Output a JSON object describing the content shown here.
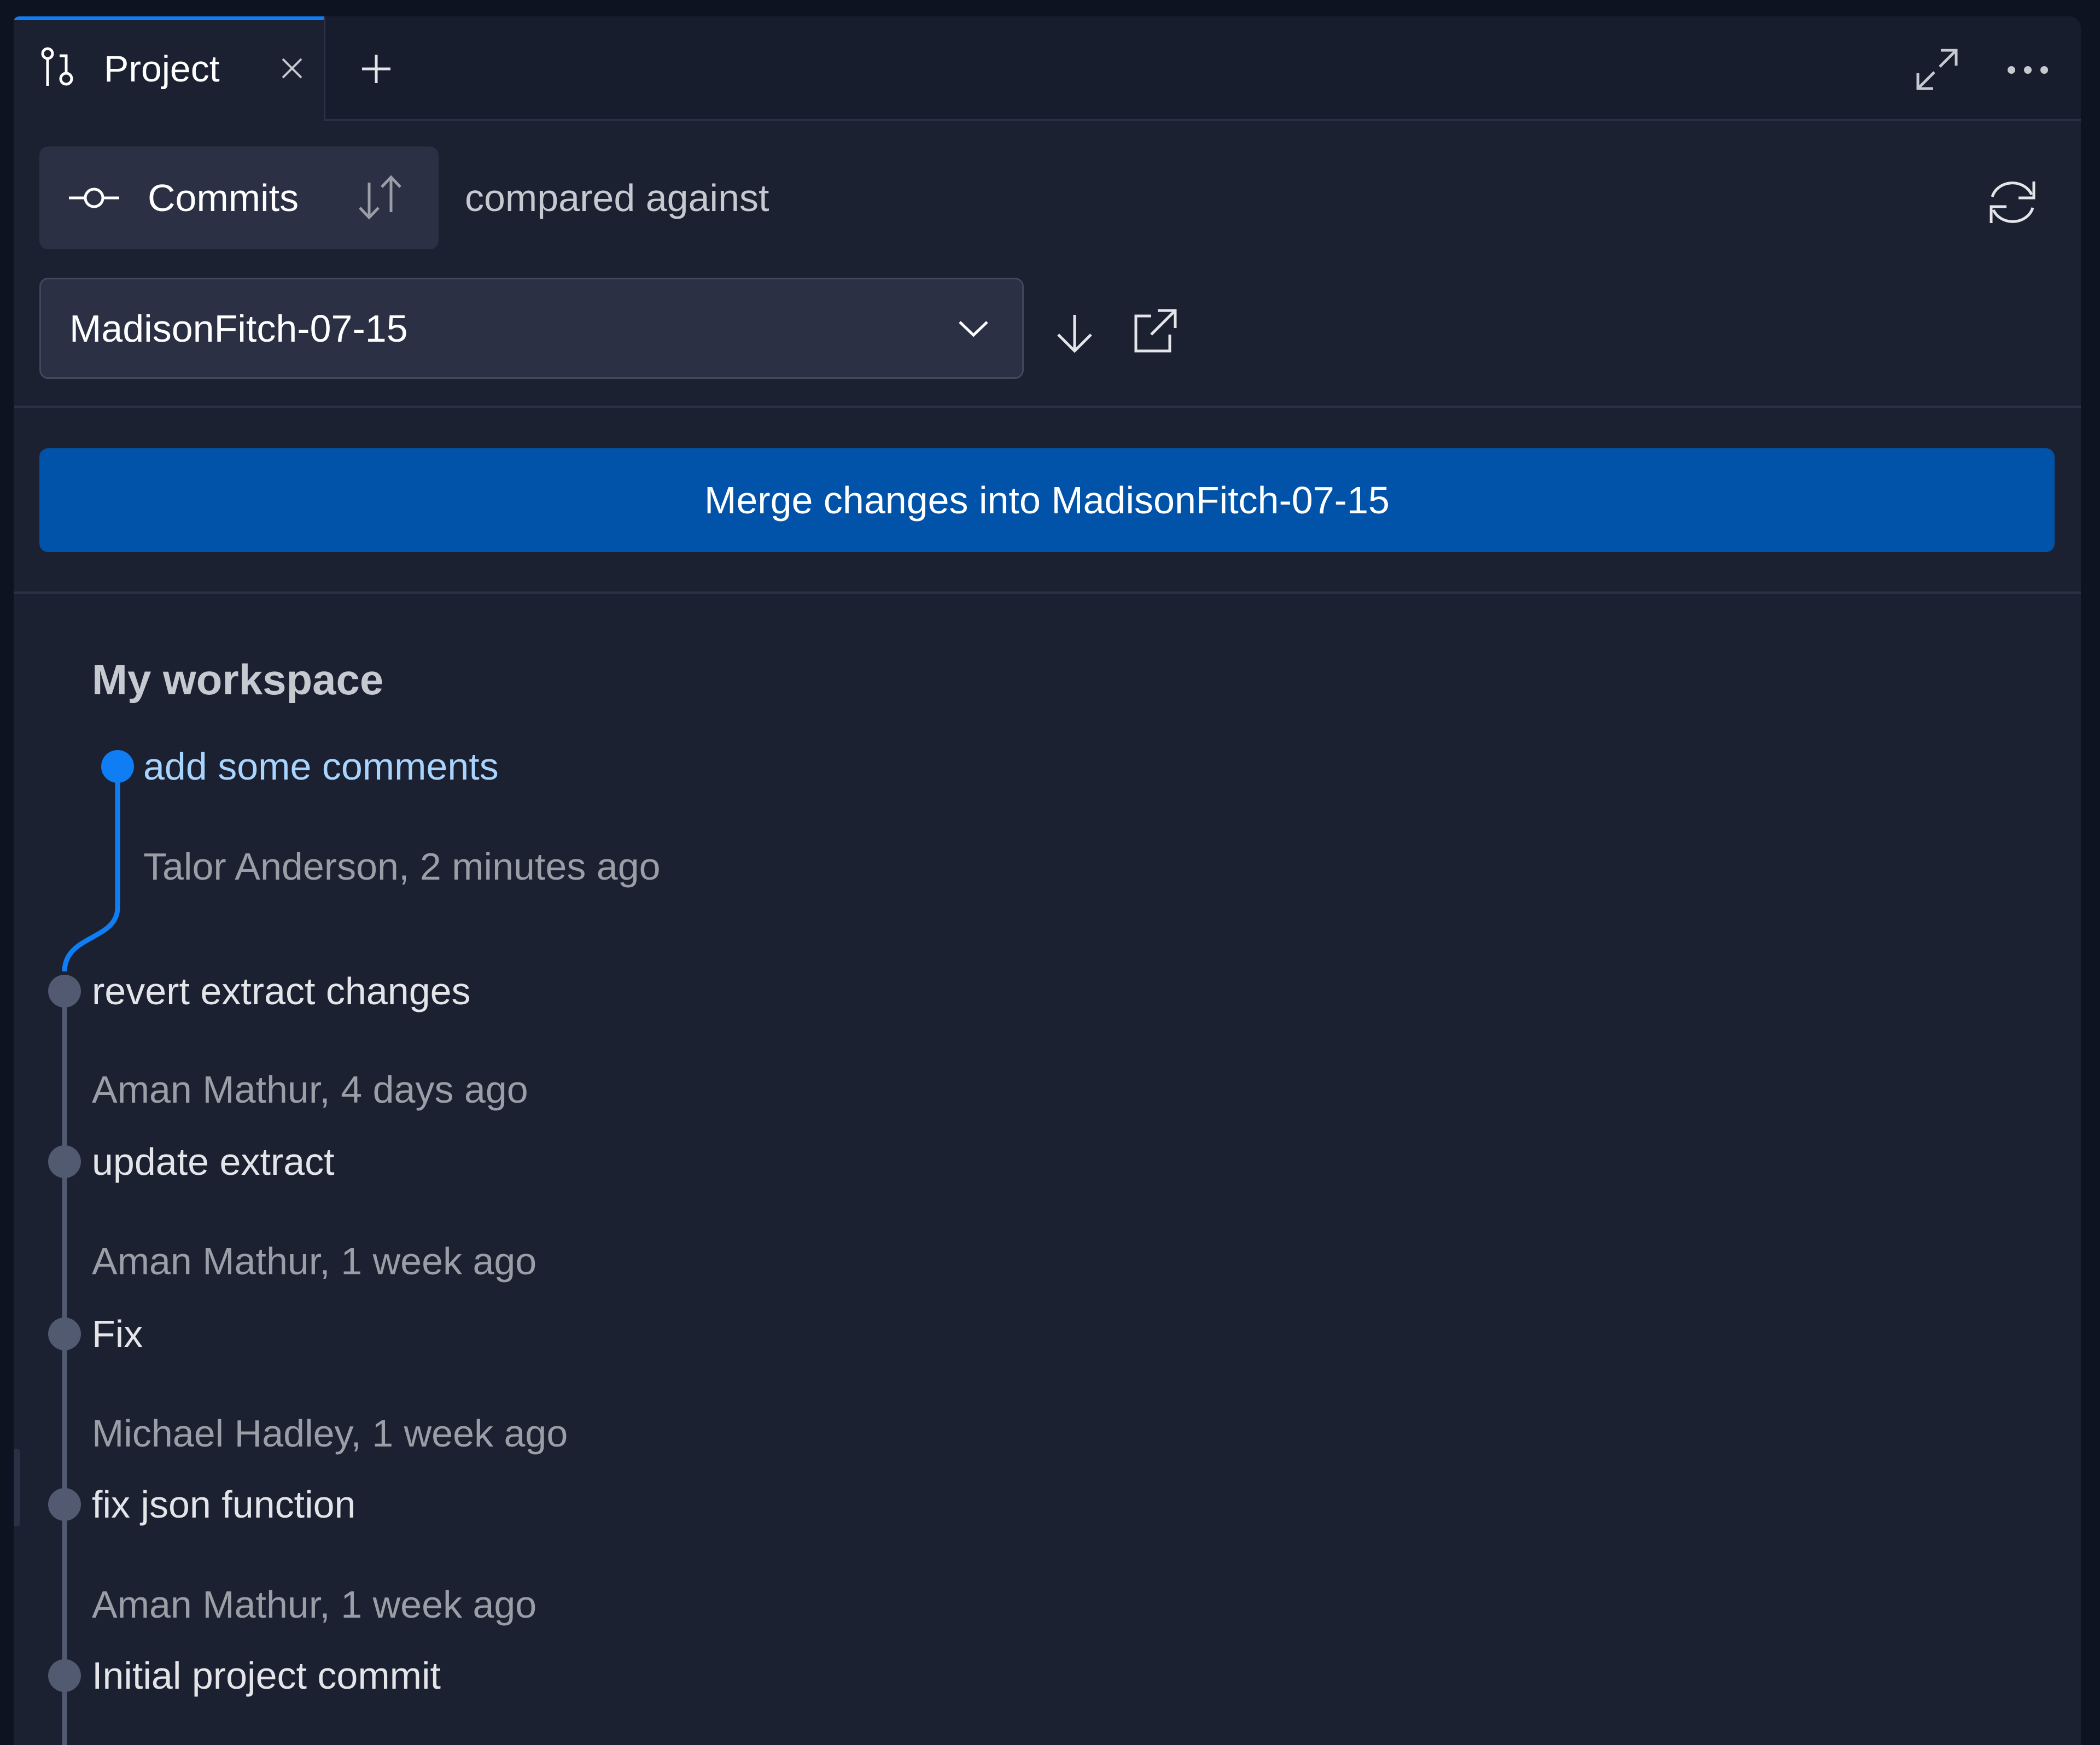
{
  "tabs": [
    {
      "label": "Project",
      "icon": "git-branch-icon",
      "active": true
    }
  ],
  "tabbar": {
    "add_tab_icon": "plus-icon",
    "maximize_icon": "maximize-icon",
    "more_icon": "ellipsis-icon"
  },
  "toolbar": {
    "view_mode_label": "Commits",
    "view_mode_icon": "commit-icon",
    "sort_icon": "sort-arrows-icon",
    "compared_label": "compared against",
    "refresh_icon": "refresh-icon"
  },
  "branch_select": {
    "value": "MadisonFitch-07-15",
    "download_icon": "download-arrow-icon",
    "open_external_icon": "external-link-icon"
  },
  "merge_button": {
    "label": "Merge changes into MadisonFitch-07-15"
  },
  "colors": {
    "accent": "#0f7ef5",
    "merge_button": "#0053a8",
    "active_commit_text": "#a8d5ff",
    "panel_bg": "#1c2131"
  },
  "workspace": {
    "title": "My workspace",
    "commits": [
      {
        "title": "add some comments",
        "meta": "Talor Anderson, 2 minutes ago",
        "active": true
      },
      {
        "title": "revert extract changes",
        "meta": "Aman Mathur, 4 days ago",
        "active": false
      },
      {
        "title": "update extract",
        "meta": "Aman Mathur, 1 week ago",
        "active": false
      },
      {
        "title": "Fix",
        "meta": "Michael Hadley, 1 week ago",
        "active": false
      },
      {
        "title": "fix json function",
        "meta": "Aman Mathur, 1 week ago",
        "active": false
      },
      {
        "title": "Initial project commit",
        "meta": "",
        "active": false
      }
    ]
  }
}
